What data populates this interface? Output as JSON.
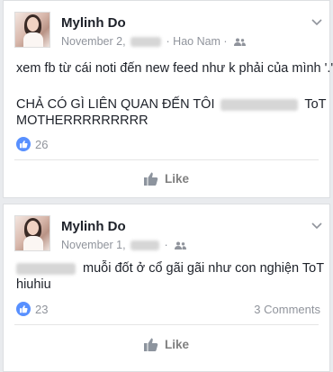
{
  "posts": [
    {
      "author": "Mylinh Do",
      "date": "November 2,",
      "location": "· Hao Nam ·",
      "line1": "xem fb từ cái noti đến new feed như k phải của mình '.'",
      "line2_start": "CHẢ CÓ GÌ LIÊN QUAN ĐẾN TÔI",
      "line2_end": "ToT",
      "line3": "MOTHERRRRRRRRR",
      "reaction_count": "26",
      "like_label": "Like"
    },
    {
      "author": "Mylinh Do",
      "date": "November 1,",
      "line1_end": "muỗi đốt ở cổ gãi gãi như con nghiện ToT",
      "line2": "hiuhiu",
      "reaction_count": "23",
      "comments": "3 Comments",
      "like_label": "Like"
    }
  ],
  "icons": {
    "reaction": "thumbs-up-icon",
    "audience": "friends-icon",
    "menu": "chevron-down-icon",
    "like": "thumbs-up-icon"
  },
  "colors": {
    "like_badge": "#5890ff",
    "meta_text": "#90949c",
    "background": "#e9ebee"
  }
}
